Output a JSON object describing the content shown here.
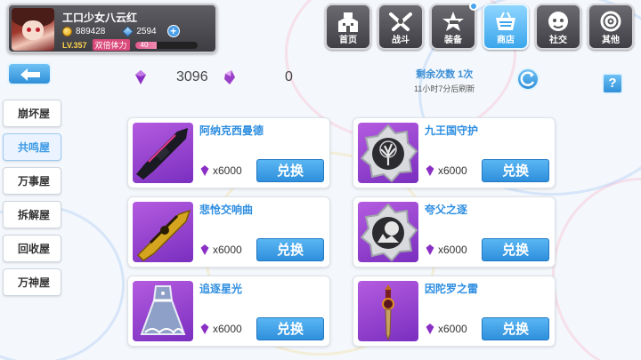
{
  "profile": {
    "name": "工口少女八云红",
    "gold": "889428",
    "gems": "2594",
    "level": "LV.357",
    "stamina_label": "双倍体力",
    "stamina_value": "40",
    "stamina_fraction": 0.35
  },
  "nav": [
    {
      "label": "首页",
      "icon": "home-icon"
    },
    {
      "label": "战斗",
      "icon": "swords-icon"
    },
    {
      "label": "装备",
      "icon": "star-gun-icon"
    },
    {
      "label": "商店",
      "icon": "shop-basket-icon",
      "active": true
    },
    {
      "label": "社交",
      "icon": "face-icon"
    },
    {
      "label": "其他",
      "icon": "settings-icon"
    }
  ],
  "sidebar": {
    "items": [
      {
        "label": "崩坏屋"
      },
      {
        "label": "共鸣屋",
        "active": true
      },
      {
        "label": "万事屋"
      },
      {
        "label": "拆解屋"
      },
      {
        "label": "回收屋"
      },
      {
        "label": "万神屋"
      }
    ]
  },
  "currency": {
    "crystal_a": "3096",
    "crystal_b": "0"
  },
  "refresh": {
    "count": "剩余次数 1次",
    "time": "11小时7分后刷新"
  },
  "help_label": "?",
  "products": [
    {
      "name": "阿纳克西曼德",
      "price": "x6000",
      "button": "兑换",
      "thumb": "rifle"
    },
    {
      "name": "九王国守护",
      "price": "x6000",
      "button": "兑换",
      "thumb": "tree-medal"
    },
    {
      "name": "悲怆交响曲",
      "price": "x6000",
      "button": "兑换",
      "thumb": "gold-gun"
    },
    {
      "name": "夸父之逐",
      "price": "x6000",
      "button": "兑换",
      "thumb": "sun-medal"
    },
    {
      "name": "追逐星光",
      "price": "x6000",
      "button": "兑换",
      "thumb": "dress"
    },
    {
      "name": "因陀罗之雷",
      "price": "x6000",
      "button": "兑换",
      "thumb": "dagger"
    }
  ],
  "colors": {
    "accent": "#2e8fdc",
    "title_blue": "#2e8ee0",
    "crystal": "#8a2fc4"
  }
}
